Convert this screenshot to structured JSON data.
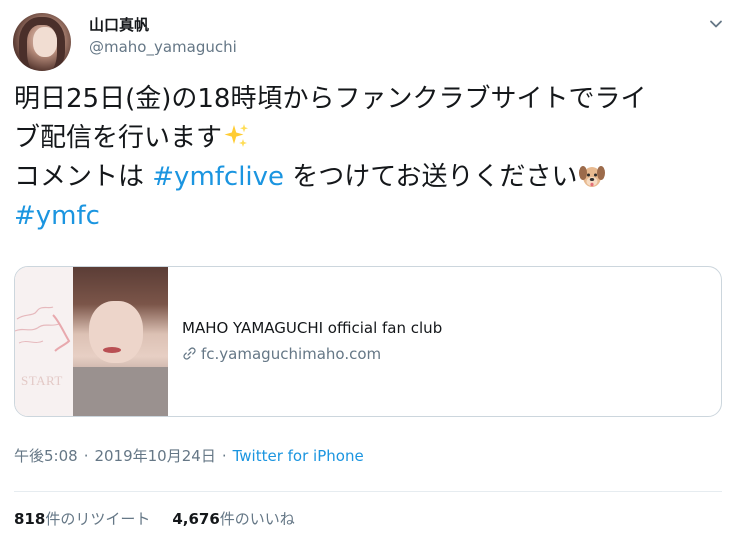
{
  "author": {
    "name": "山口真帆",
    "handle": "@maho_yamaguchi"
  },
  "tweet": {
    "line1": "明日25日(金)の18時頃からファンクラブサイトでライ",
    "line2": "ブ配信を行います",
    "line3_prefix": "コメントは ",
    "hashtag1": "#ymfclive",
    "line3_suffix": " をつけてお送りください",
    "hashtag2": "#ymfc",
    "emoji_sparkle": "sparkles-emoji",
    "emoji_dog": "dog-face-emoji"
  },
  "card": {
    "title": "MAHO YAMAGUCHI official fan club",
    "url": "fc.yamaguchimaho.com",
    "image_caption": "START"
  },
  "meta": {
    "time": "午後5:08",
    "date": "2019年10月24日",
    "separator": "·",
    "source": "Twitter for iPhone"
  },
  "stats": {
    "retweets_count": "818",
    "retweets_label": "件のリツイート",
    "likes_count": "4,676",
    "likes_label": "件のいいね"
  },
  "colors": {
    "link": "#1b95e0",
    "secondary": "#657786",
    "text": "#14171a",
    "border": "#ccd6dd"
  }
}
